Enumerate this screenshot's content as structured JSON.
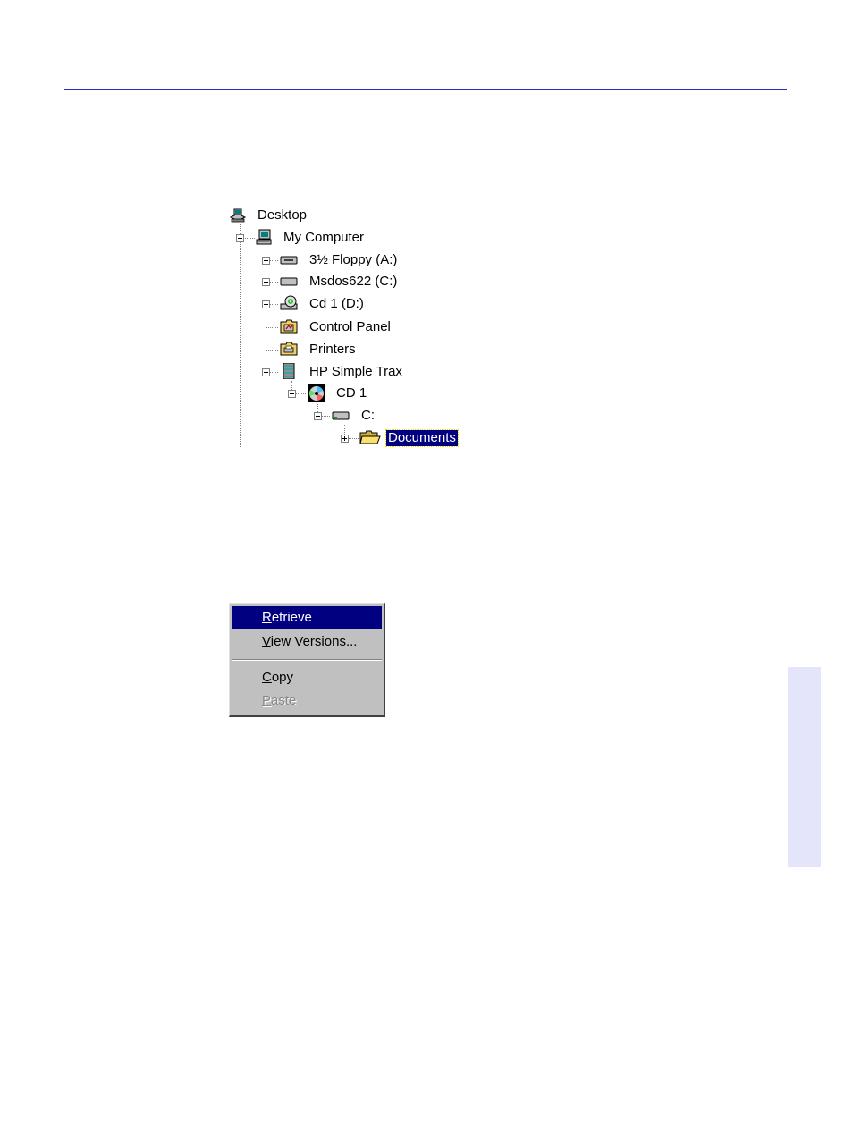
{
  "tree": {
    "items": [
      {
        "label": "Desktop",
        "icon": "desktop-icon"
      },
      {
        "label": "My Computer",
        "icon": "computer-icon"
      },
      {
        "label": "3½ Floppy (A:)",
        "icon": "floppy-drive-icon"
      },
      {
        "label": "Msdos622 (C:)",
        "icon": "hard-drive-icon"
      },
      {
        "label": "Cd 1 (D:)",
        "icon": "cd-drive-icon"
      },
      {
        "label": "Control Panel",
        "icon": "control-panel-folder-icon"
      },
      {
        "label": "Printers",
        "icon": "printers-folder-icon"
      },
      {
        "label": "HP Simple Trax",
        "icon": "hp-simple-trax-icon"
      },
      {
        "label": "CD 1",
        "icon": "cd-disc-icon"
      },
      {
        "label": "C:",
        "icon": "drive-icon"
      },
      {
        "label": "Documents",
        "icon": "open-folder-icon",
        "selected": true
      }
    ]
  },
  "menu": {
    "items": [
      {
        "mnemonic": "R",
        "rest": "etrieve",
        "state": "highlighted"
      },
      {
        "mnemonic": "V",
        "rest": "iew Versions...",
        "state": "normal"
      },
      {
        "mnemonic": "C",
        "rest": "opy",
        "state": "normal"
      },
      {
        "mnemonic": "P",
        "rest": "aste",
        "state": "disabled"
      }
    ]
  },
  "colors": {
    "rule": "#2a2ad0",
    "side_tab": "#e4e4fa",
    "selection": "#000080",
    "menu_bg": "#c0c0c0"
  }
}
